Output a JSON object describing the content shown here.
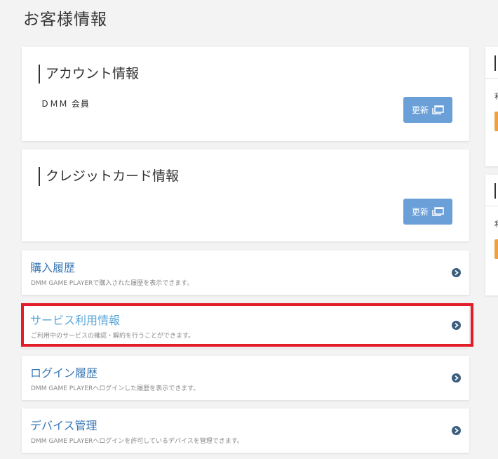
{
  "page": {
    "title": "お客様情報"
  },
  "account": {
    "heading": "アカウント情報",
    "member_label": "ＤＭＭ 会員",
    "update_label": "更新"
  },
  "credit": {
    "heading": "クレジットカード情報",
    "update_label": "更新"
  },
  "nav": [
    {
      "title": "購入履歴",
      "desc": "DMM GAME PLAYERで購入された履歴を表示できます。"
    },
    {
      "title": "サービス利用情報",
      "desc": "ご利用中のサービスの確認・解約を行うことができます。"
    },
    {
      "title": "ログイン履歴",
      "desc": "DMM GAME PLAYERへログインした履歴を表示できます。"
    },
    {
      "title": "デバイス管理",
      "desc": "DMM GAME PLAYERへログインを許可しているデバイスを管理できます。"
    }
  ],
  "side": {
    "char1": "利",
    "char2": "利"
  },
  "colors": {
    "accent_button": "#6a9fd8",
    "link": "#3a78b5",
    "highlight": "#e21d2a",
    "arrow": "#3b5f7f",
    "orange": "#f0a040"
  },
  "icons": {
    "update": "window-icon",
    "nav_arrow": "chevron-right-circle-icon"
  }
}
